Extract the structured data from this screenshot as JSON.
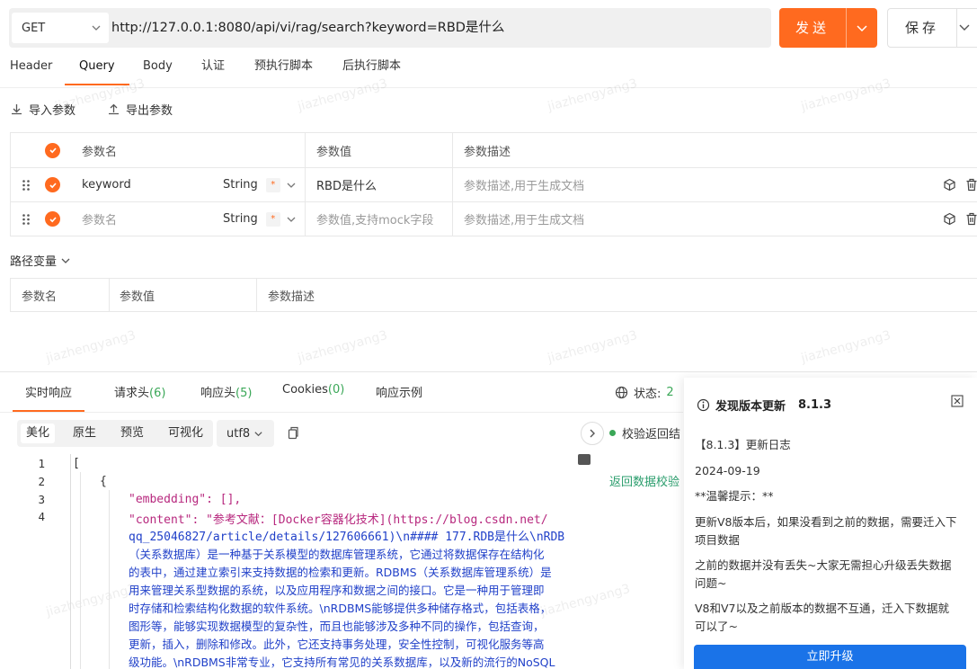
{
  "request": {
    "method": "GET",
    "url": "http://127.0.0.1:8080/api/vi/rag/search?keyword=RBD是什么",
    "send_label": "发送",
    "save_label": "保存"
  },
  "request_tabs": [
    "Header",
    "Query",
    "Body",
    "认证",
    "预执行脚本",
    "后执行脚本"
  ],
  "import_label": "导入参数",
  "export_label": "导出参数",
  "query_table": {
    "headers": {
      "name": "参数名",
      "value": "参数值",
      "desc": "参数描述"
    },
    "rows": [
      {
        "name": "keyword",
        "type": "String",
        "required": "*",
        "value": "RBD是什么",
        "desc": "参数描述,用于生成文档"
      },
      {
        "name": "参数名",
        "type": "String",
        "required": "*",
        "value": "参数值,支持mock字段",
        "desc": "参数描述,用于生成文档"
      }
    ]
  },
  "path_vars": {
    "label": "路径变量",
    "headers": {
      "name": "参数名",
      "value": "参数值",
      "desc": "参数描述"
    }
  },
  "watermark": "jiazhengyang3",
  "response_tabs": [
    {
      "label": "实时响应",
      "count": ""
    },
    {
      "label": "请求头",
      "count": "(6)"
    },
    {
      "label": "响应头",
      "count": "(5)"
    },
    {
      "label": "Cookies",
      "count": "(0)"
    },
    {
      "label": "响应示例",
      "count": ""
    }
  ],
  "status": {
    "label": "状态:",
    "value": "2"
  },
  "format_tabs": [
    "美化",
    "原生",
    "预览",
    "可视化"
  ],
  "encoding": "utf8",
  "code": {
    "line_numbers": [
      "1",
      "2",
      "3",
      "4"
    ],
    "lines": [
      "[",
      "{",
      "\"embedding\": [],",
      "\"content\": \"参考文献：[Docker容器化技术](https://blog.csdn.net/",
      "qq_25046827/article/details/127606661)\\n#### 177.RDB是什么\\nRDB",
      "（关系数据库）是一种基于关系模型的数据库管理系统，它通过将数据保存在结构化",
      "的表中，通过建立索引来支持数据的检索和更新。RDBMS（关系数据库管理系统）是",
      "用来管理关系型数据的系统，以及应用程序和数据之间的接口。它是一种用于管理即",
      "时存储和检索结构化数据的软件系统。\\nRDBMS能够提供多种储存格式，包括表格，",
      "图形等，能够实现数据模型的复杂性，而且也能够涉及多种不同的操作，包括查询，",
      "更新，插入，删除和修改。此外，它还支持事务处理，安全性控制，可视化服务等高",
      "级功能。\\nRDBMS非常专业，它支持所有常见的关系数据库，以及新的流行的NoSQL"
    ]
  },
  "validate": {
    "label": "校验返回结",
    "link": "返回数据校验"
  },
  "update_panel": {
    "title": "发现版本更新",
    "version": "8.1.3",
    "changelog": "【8.1.3】更新日志",
    "date": "2024-09-19",
    "tip": "**温馨提示：**",
    "p1": "更新V8版本后，如果没看到之前的数据，需要迁入下项目数据",
    "p2": "之前的数据并没有丢失~大家无需担心升级丢失数据问题~",
    "p3": "V8和V7以及之前版本的数据不互通，迁入下数据就可以了~",
    "button": "立即升级"
  }
}
